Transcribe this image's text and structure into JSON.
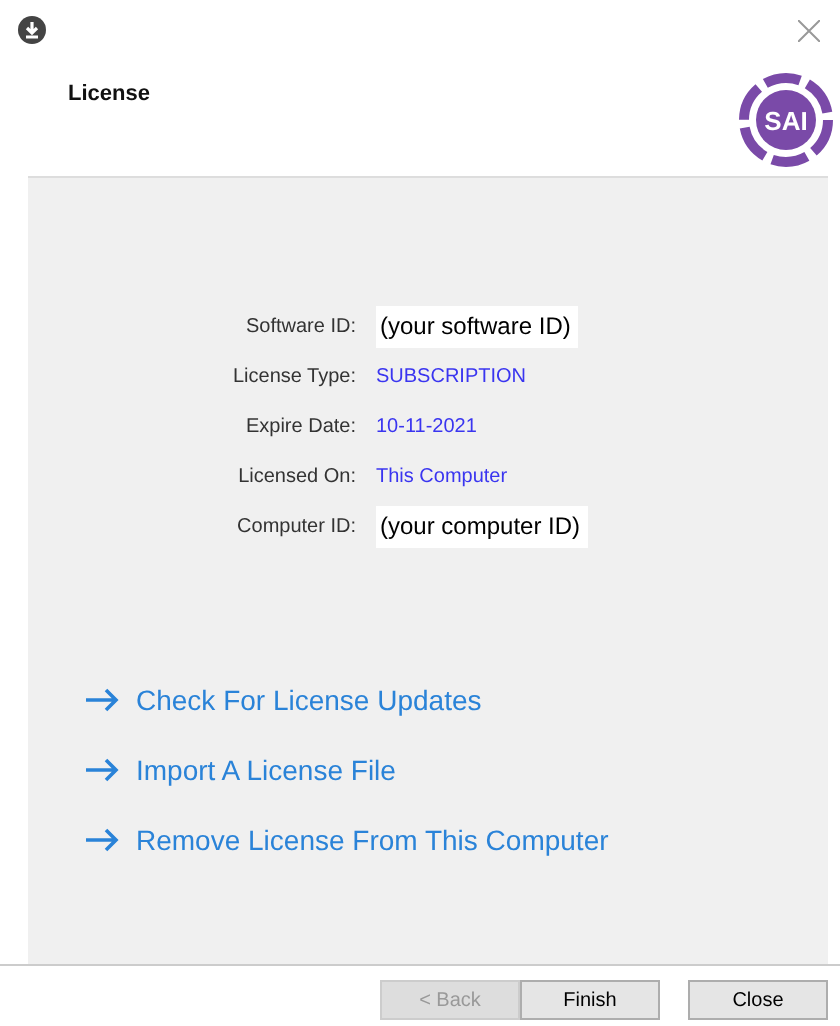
{
  "window": {
    "title": "License",
    "logo_text": "SAI"
  },
  "fields": [
    {
      "label": "Software ID:",
      "value": "(your software ID)",
      "kind": "box"
    },
    {
      "label": "License Type:",
      "value": "SUBSCRIPTION",
      "kind": "plain"
    },
    {
      "label": "Expire Date:",
      "value": "10-11-2021",
      "kind": "plain"
    },
    {
      "label": "Licensed On:",
      "value": "This Computer",
      "kind": "plain"
    },
    {
      "label": "Computer ID:",
      "value": "(your computer ID)",
      "kind": "box"
    }
  ],
  "links": [
    "Check For License Updates",
    "Import A License File",
    "Remove License From This Computer"
  ],
  "buttons": [
    {
      "label": "< Back",
      "disabled": true
    },
    {
      "label": "Finish",
      "disabled": false
    },
    {
      "label": "Close",
      "disabled": false
    }
  ]
}
